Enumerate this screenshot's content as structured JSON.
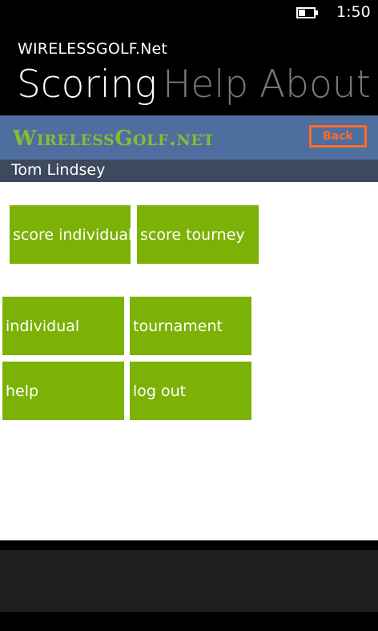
{
  "status_bar": {
    "time": "1:50",
    "battery_level": 0.45,
    "battery_icon": "battery-icon"
  },
  "app": {
    "title": "WIRELESSGOLF.Net"
  },
  "pivot": {
    "items": [
      {
        "label": "Scoring",
        "active": true
      },
      {
        "label": "Help",
        "active": false
      },
      {
        "label": "About",
        "active": false
      }
    ]
  },
  "brand": {
    "logo_text": "WirelessGolf.net",
    "back_label": "Back",
    "logo_color": "#83bd34",
    "back_color": "#ff6a2a",
    "bar_color": "#4e6e9f"
  },
  "user": {
    "name": "Tom Lindsey"
  },
  "tiles": {
    "score_individual": "score individual",
    "score_tourney": "score tourney",
    "individual": "individual",
    "tournament": "tournament",
    "help": "help",
    "log_out": "log out",
    "color": "#7bb205"
  }
}
